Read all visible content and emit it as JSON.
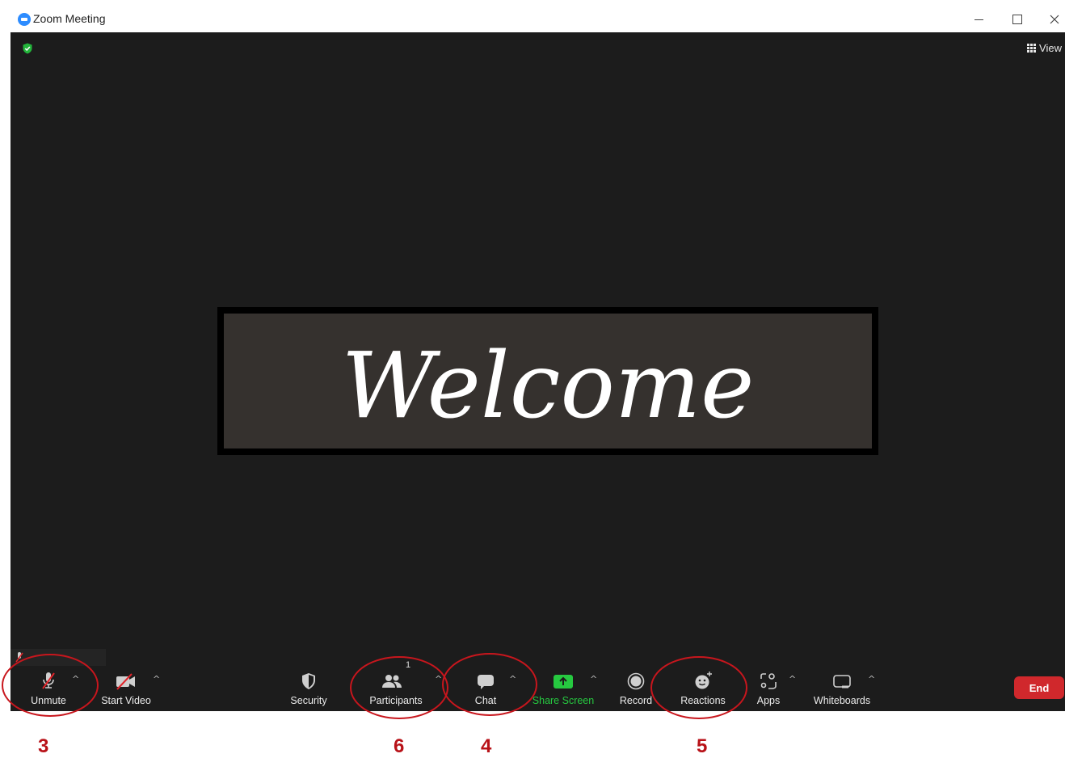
{
  "window": {
    "title": "Zoom Meeting"
  },
  "meeting": {
    "view_label": "View",
    "welcome_text": "Welcome"
  },
  "toolbar": {
    "unmute": "Unmute",
    "start_video": "Start Video",
    "security": "Security",
    "participants": "Participants",
    "participant_count": "1",
    "chat": "Chat",
    "share_screen": "Share Screen",
    "record": "Record",
    "reactions": "Reactions",
    "apps": "Apps",
    "whiteboards": "Whiteboards",
    "end": "End"
  },
  "annotations": {
    "unmute": "3",
    "participants": "6",
    "chat": "4",
    "reactions": "5"
  },
  "colors": {
    "meeting_bg": "#1c1c1c",
    "share_green": "#26c940",
    "end_red": "#d0282c",
    "annotation_red": "#c8161d"
  },
  "icons": [
    "zoom-logo-icon",
    "minimize-icon",
    "maximize-icon",
    "close-icon",
    "security-shield-icon",
    "grid-view-icon",
    "microphone-muted-icon",
    "video-off-icon",
    "shield-icon",
    "participants-icon",
    "chat-bubble-icon",
    "share-screen-arrow-icon",
    "record-icon",
    "reaction-smiley-icon",
    "apps-icon",
    "whiteboard-icon",
    "caret-up-icon"
  ]
}
